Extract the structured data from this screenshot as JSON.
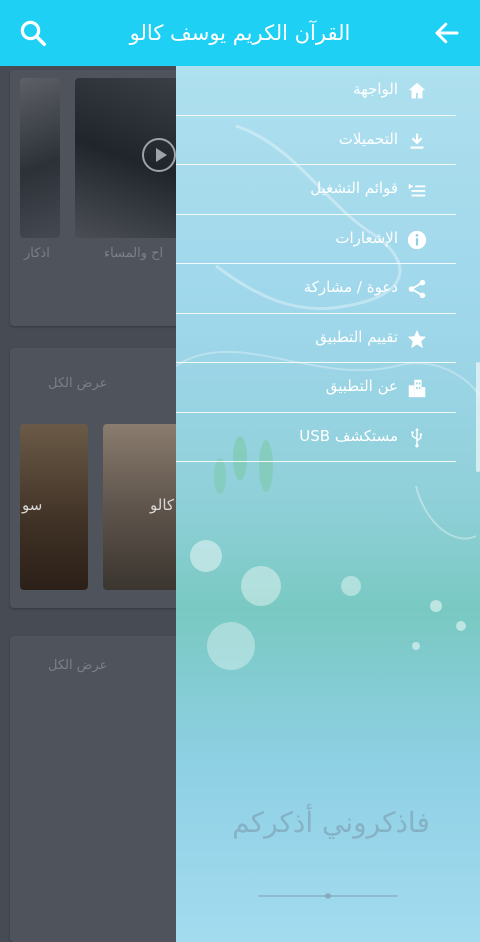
{
  "appbar": {
    "title": "القرآن الكريم يوسف كالو",
    "search_icon": "search-icon",
    "back_icon": "arrow-back-icon"
  },
  "background": {
    "section1": {
      "cards": [
        "اذكار",
        "اح والمساء"
      ]
    },
    "section2": {
      "see_all": "عرض الكل",
      "cards": [
        "كالو",
        "سو"
      ]
    },
    "section3": {
      "see_all": "عرض الكل"
    }
  },
  "drawer": {
    "items": [
      {
        "label": "الواجهة",
        "icon": "home-icon"
      },
      {
        "label": "التحميلات",
        "icon": "download-icon"
      },
      {
        "label": "قوائم التشغيل",
        "icon": "playlist-icon"
      },
      {
        "label": "الإشعارات",
        "icon": "info-icon"
      },
      {
        "label": "دعوة / مشاركة",
        "icon": "share-icon"
      },
      {
        "label": "تقييم التطبيق",
        "icon": "star-icon"
      },
      {
        "label": "عن التطبيق",
        "icon": "building-icon"
      },
      {
        "label": "مستكشف USB",
        "icon": "usb-icon"
      }
    ],
    "calligraphy": "فاذكروني أذكركم"
  },
  "colors": {
    "appbar": "#1fd0f5",
    "overlay": "#464b54",
    "icon": "#ffffff"
  }
}
